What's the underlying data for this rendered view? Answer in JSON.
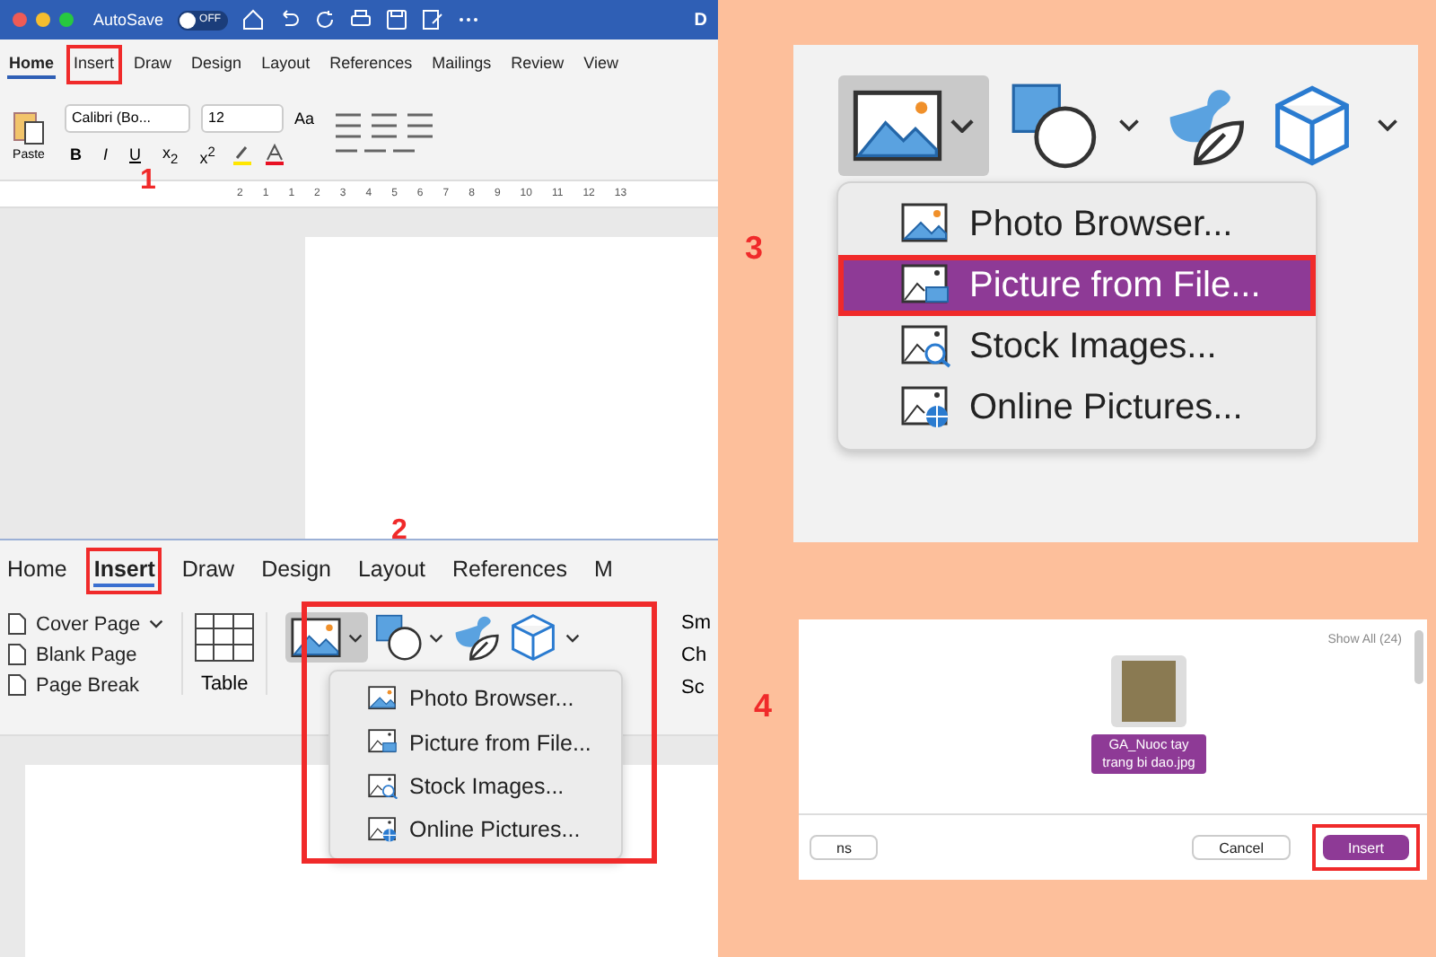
{
  "panel_1": {
    "step": "1",
    "title_bar": {
      "autosave_label": "AutoSave",
      "autosave_toggle": "OFF",
      "autosave_on": false,
      "title": "D"
    },
    "tabs": [
      {
        "label": "Home",
        "selected": true,
        "highlighted": false
      },
      {
        "label": "Insert",
        "selected": false,
        "highlighted": true
      },
      {
        "label": "Draw",
        "selected": false,
        "highlighted": false
      },
      {
        "label": "Design",
        "selected": false,
        "highlighted": false
      },
      {
        "label": "Layout",
        "selected": false,
        "highlighted": false
      },
      {
        "label": "References",
        "selected": false,
        "highlighted": false
      },
      {
        "label": "Mailings",
        "selected": false,
        "highlighted": false
      },
      {
        "label": "Review",
        "selected": false,
        "highlighted": false
      },
      {
        "label": "View",
        "selected": false,
        "highlighted": false
      }
    ],
    "ribbon": {
      "paste_label": "Paste",
      "font_name": "Calibri (Bo...",
      "font_size": "12",
      "case_label": "Aa",
      "format_buttons": [
        {
          "label": "B",
          "kind": "bold"
        },
        {
          "label": "I",
          "kind": "italic"
        },
        {
          "label": "U",
          "kind": "underline"
        },
        {
          "label": "x$_{2}$",
          "kind": "script"
        },
        {
          "label": "x$^{2}$",
          "kind": "script"
        }
      ]
    },
    "ruler": [
      "2",
      "1",
      "1",
      "2",
      "3",
      "4",
      "5",
      "6",
      "7",
      "8",
      "9",
      "10",
      "11",
      "12",
      "13"
    ]
  },
  "panel_2": {
    "step": "2",
    "tabs": [
      {
        "label": "Home",
        "selected": false,
        "highlighted": false
      },
      {
        "label": "Insert",
        "selected": true,
        "highlighted": true
      },
      {
        "label": "Draw",
        "selected": false,
        "highlighted": false
      },
      {
        "label": "Design",
        "selected": false,
        "highlighted": false
      },
      {
        "label": "Layout",
        "selected": false,
        "highlighted": false
      },
      {
        "label": "References",
        "selected": false,
        "highlighted": false
      },
      {
        "label": "M",
        "selected": false,
        "highlighted": false
      }
    ],
    "page_commands": [
      {
        "label": "Cover Page",
        "dropdown": true
      },
      {
        "label": "Blank Page",
        "dropdown": false
      },
      {
        "label": "Page Break",
        "dropdown": false
      }
    ],
    "table_label": "Table",
    "side_commands": [
      "Sm",
      "Ch",
      "Sc"
    ],
    "pictures_menu": [
      {
        "label": "Photo Browser...",
        "kind": "photo",
        "selected": false
      },
      {
        "label": "Picture from File...",
        "kind": "file",
        "selected": false
      },
      {
        "label": "Stock Images...",
        "kind": "stock",
        "selected": false
      },
      {
        "label": "Online Pictures...",
        "kind": "online",
        "selected": false
      }
    ]
  },
  "panel_3": {
    "step": "3",
    "pictures_menu": [
      {
        "label": "Photo Browser...",
        "kind": "photo",
        "selected": false,
        "highlighted": false
      },
      {
        "label": "Picture from File...",
        "kind": "file",
        "selected": true,
        "highlighted": true
      },
      {
        "label": "Stock Images...",
        "kind": "stock",
        "selected": false,
        "highlighted": false
      },
      {
        "label": "Online Pictures...",
        "kind": "online",
        "selected": false,
        "highlighted": false
      }
    ]
  },
  "panel_4": {
    "step": "4",
    "show_all": "Show All (24)",
    "file_name": "GA_Nuoc tay trang bi dao.jpg",
    "file_selected": true,
    "buttons": [
      {
        "label": "ns",
        "kind": "plain",
        "highlighted": false
      },
      {
        "label": "Cancel",
        "kind": "plain",
        "highlighted": false
      },
      {
        "label": "Insert",
        "kind": "primary",
        "highlighted": true
      }
    ]
  }
}
